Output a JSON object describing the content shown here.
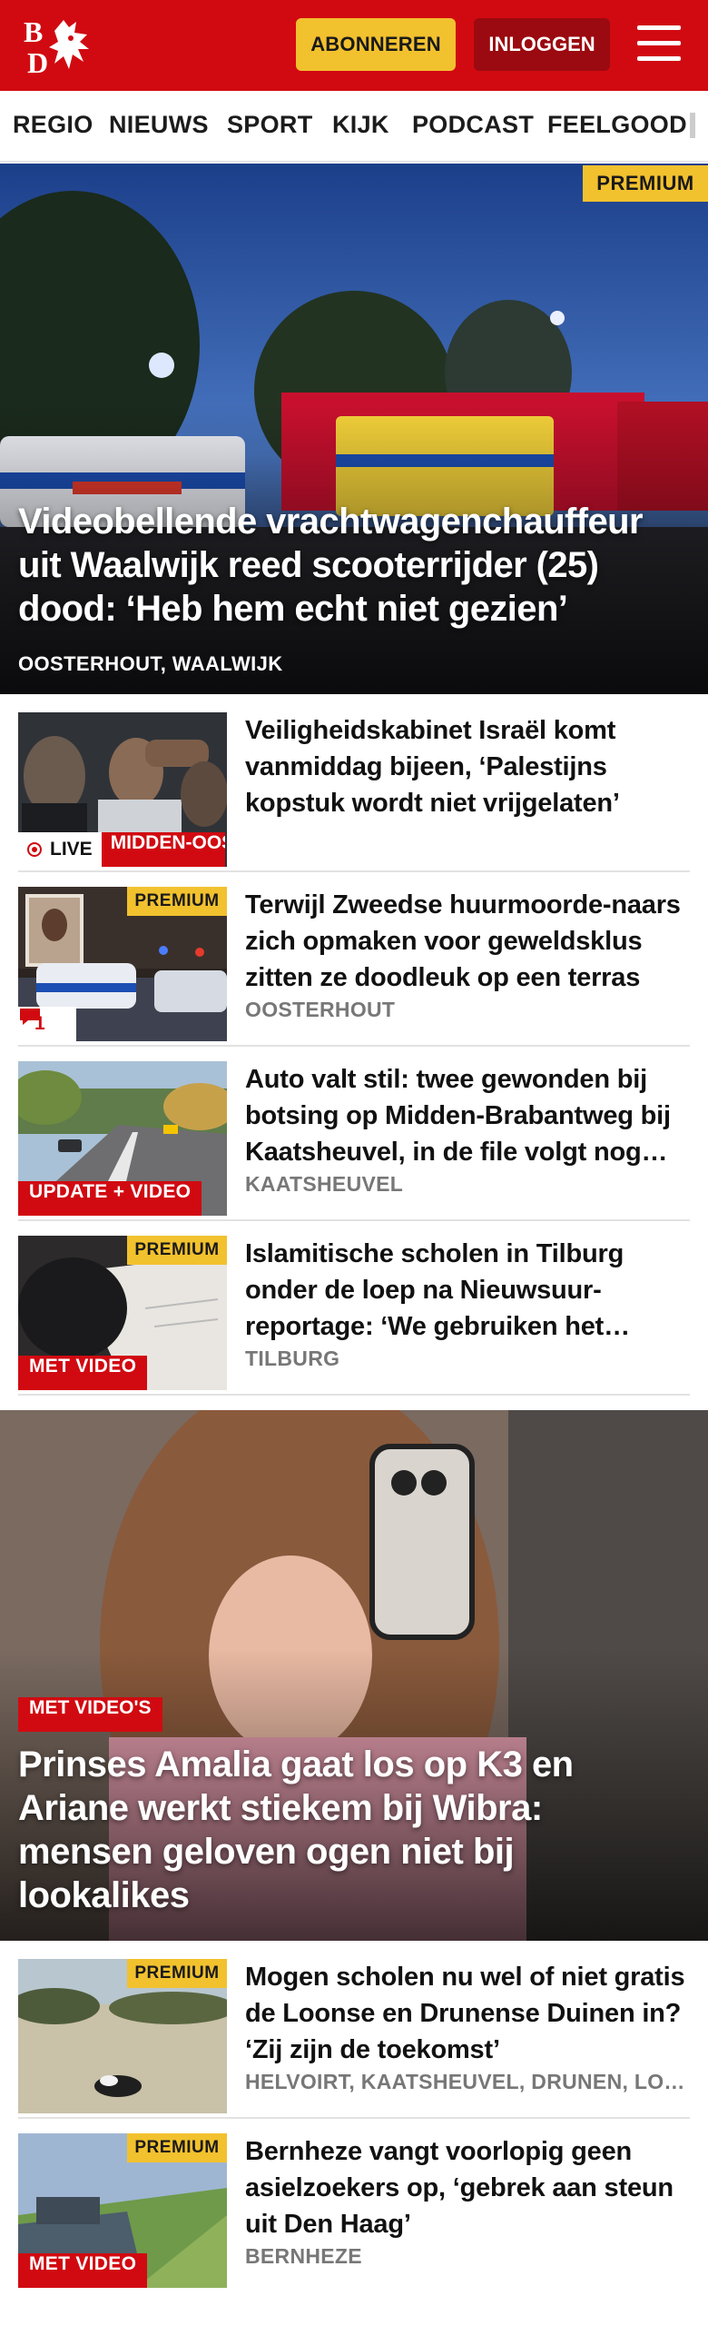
{
  "header": {
    "logo_text": "BD",
    "subscribe_label": "ABONNEREN",
    "login_label": "INLOGGEN",
    "brand_color": "#d10a11"
  },
  "nav": {
    "items": [
      "REGIO",
      "NIEUWS",
      "SPORT",
      "KIJK",
      "PODCAST",
      "FEELGOOD"
    ]
  },
  "hero": {
    "badge": "PREMIUM",
    "title": "Videobellende vrachtwagenchauffeur uit Waalwijk reed scooterrijder (25) dood: ‘Heb hem echt niet gezien’",
    "location": "OOSTERHOUT, WAALWIJK"
  },
  "articles": [
    {
      "title": "Veiligheidskabinet Israël komt vanmiddag bijeen, ‘Palestijns kopstuk wordt niet vrijgelaten’",
      "location": "",
      "live_label": "LIVE",
      "tag": "MIDDEN-OOSTEN"
    },
    {
      "title": "Terwijl Zweedse huurmoorde-naars zich opmaken voor geweldsklus zitten ze doodleuk op een terras",
      "location": "OOSTERHOUT",
      "badge": "PREMIUM",
      "comments": "1"
    },
    {
      "title": "Auto valt stil: twee gewonden bij botsing op Midden-Brabantweg bij Kaatsheuvel, in de file volgt nog een botsing",
      "location": "KAATSHEUVEL",
      "tag": "UPDATE + VIDEO"
    },
    {
      "title": "Islamitische scholen in Tilburg onder de loep na Nieuwsuur-reportage: ‘We gebruiken het lesmateriaal niet’",
      "location": "TILBURG",
      "badge": "PREMIUM",
      "tag": "MET VIDEO"
    }
  ],
  "feature": {
    "tag": "MET VIDEO'S",
    "title": "Prinses Amalia gaat los op K3 en Ariane werkt stiekem bij Wibra: mensen geloven ogen niet bij lookalikes"
  },
  "articles2": [
    {
      "title": "Mogen scholen nu wel of niet gratis de Loonse en Drunense Duinen in? ‘Zij zijn de toekomst’",
      "location": "HELVOIRT, KAATSHEUVEL, DRUNEN, LOON OP ZAND",
      "badge": "PREMIUM"
    },
    {
      "title": "Bernheze vangt voorlopig geen asielzoekers op, ‘gebrek aan steun uit Den Haag’",
      "location": "BERNHEZE",
      "badge": "PREMIUM",
      "tag": "MET VIDEO"
    }
  ]
}
